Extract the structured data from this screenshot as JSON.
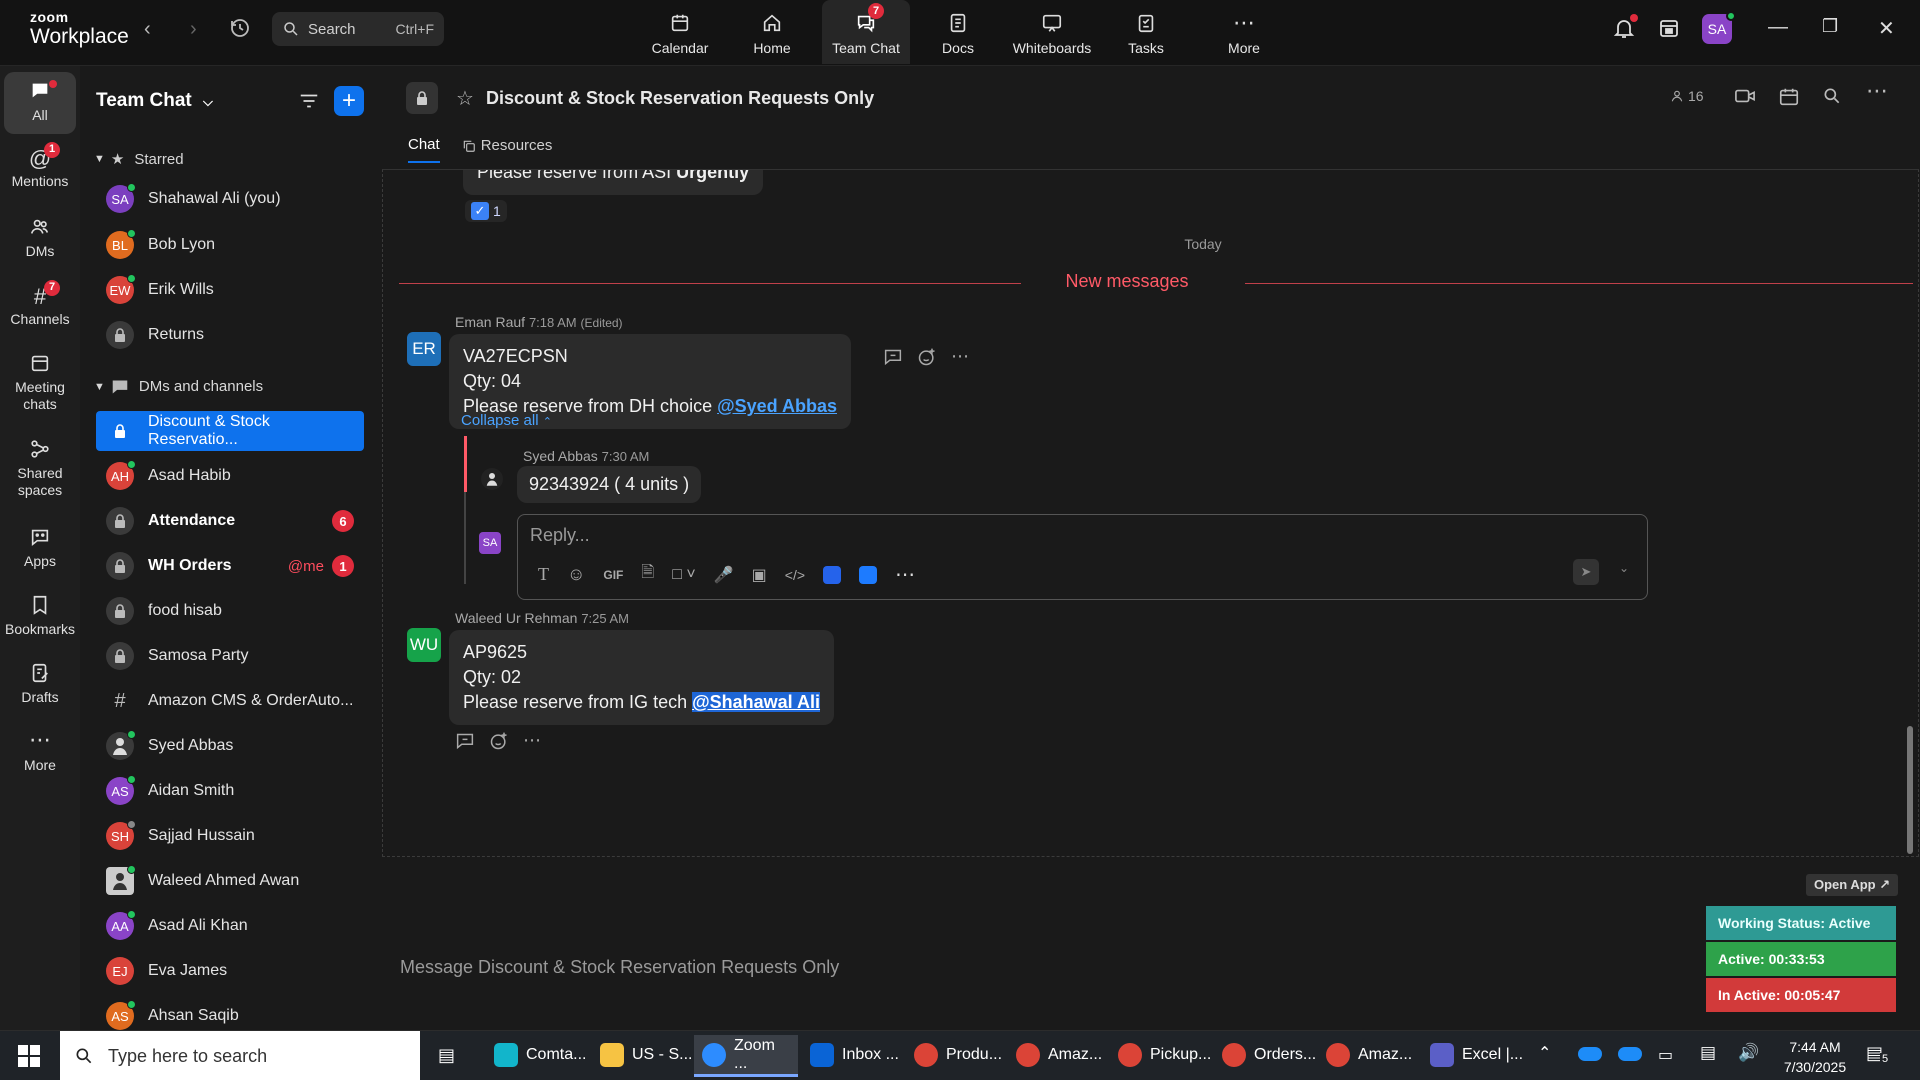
{
  "app": {
    "brand_top": "zoom",
    "brand_bottom": "Workplace"
  },
  "topbar": {
    "search_label": "Search",
    "search_shortcut": "Ctrl+F",
    "nav": [
      {
        "label": "Calendar"
      },
      {
        "label": "Home"
      },
      {
        "label": "Team Chat",
        "badge": "7"
      },
      {
        "label": "Docs"
      },
      {
        "label": "Whiteboards"
      },
      {
        "label": "Tasks"
      },
      {
        "label": "More"
      }
    ],
    "avatar_initials": "SA"
  },
  "rail": [
    {
      "label": "All"
    },
    {
      "label": "Mentions",
      "badge": "1"
    },
    {
      "label": "DMs"
    },
    {
      "label": "Channels",
      "badge": "7"
    },
    {
      "label": "Meeting chats"
    },
    {
      "label": "Shared spaces"
    },
    {
      "label": "Apps"
    },
    {
      "label": "Bookmarks"
    },
    {
      "label": "Drafts"
    },
    {
      "label": "More"
    }
  ],
  "sidebar": {
    "title": "Team Chat",
    "starred_label": "Starred",
    "starred": [
      {
        "name": "Shahawal Ali (you)",
        "initials": "SA",
        "color": "#7b3fbf"
      },
      {
        "name": "Bob Lyon",
        "initials": "BL",
        "color": "#e06b1f"
      },
      {
        "name": "Erik Wills",
        "initials": "EW",
        "color": "#d9433a"
      },
      {
        "name": "Returns",
        "initials": "",
        "color": ""
      }
    ],
    "dms_label": "DMs and channels",
    "items": [
      {
        "name": "Discount & Stock Reservatio...",
        "type": "lock"
      },
      {
        "name": "Asad Habib",
        "initials": "AH",
        "color": "#d9433a"
      },
      {
        "name": "Attendance",
        "type": "lock",
        "count": "6"
      },
      {
        "name": "WH Orders",
        "type": "lock",
        "mention": "@me",
        "count": "1"
      },
      {
        "name": "food hisab",
        "type": "lock"
      },
      {
        "name": "Samosa Party",
        "type": "lock"
      },
      {
        "name": "Amazon CMS & OrderAuto...",
        "type": "hash"
      },
      {
        "name": "Syed Abbas",
        "initials": "",
        "color": "#444"
      },
      {
        "name": "Aidan Smith",
        "initials": "AS",
        "color": "#8a44c7"
      },
      {
        "name": "Sajjad Hussain",
        "initials": "SH",
        "color": "#d9433a"
      },
      {
        "name": "Waleed Ahmed Awan",
        "initials": "",
        "color": "#555"
      },
      {
        "name": "Asad Ali Khan",
        "initials": "AA",
        "color": "#8a44c7"
      },
      {
        "name": "Eva James",
        "initials": "EJ",
        "color": "#d9433a"
      },
      {
        "name": "Ahsan Saqib",
        "initials": "AS",
        "color": "#e06b1f"
      }
    ]
  },
  "channel": {
    "title": "Discount & Stock Reservation Requests Only",
    "members": "16",
    "tabs": [
      "Chat",
      "Resources"
    ]
  },
  "messages": {
    "prev_text": "Please reserve from ASI ",
    "prev_bold": "Urgently",
    "reaction_count": "1",
    "day_label": "Today",
    "new_label": "New messages",
    "m1": {
      "sender": "Eman Rauf",
      "time": "7:18 AM",
      "edited": "(Edited)",
      "initials": "ER",
      "line1": "VA27ECPSN",
      "line2": "Qty: 04",
      "line3": "Please reserve from DH choice ",
      "mention": "@Syed Abbas"
    },
    "collapse_label": "Collapse all",
    "reply": {
      "sender": "Syed Abbas",
      "time": "7:30 AM",
      "text": "92343924 ( 4 units )"
    },
    "reply_placeholder": "Reply...",
    "reply_avatar": "SA",
    "m2": {
      "sender": "Waleed Ur Rehman",
      "time": "7:25 AM",
      "initials": "WU",
      "line1": "AP9625",
      "line2": "Qty: 02",
      "line3": "Please reserve from IG tech ",
      "mention": "@Shahawal Ali"
    }
  },
  "composer": {
    "placeholder": "Message Discount & Stock Reservation Requests Only",
    "gif": "GIF"
  },
  "widget": {
    "open_app": "Open App",
    "working": "Working Status: Active",
    "active": "Active: 00:33:53",
    "inactive": "In Active: 00:05:47",
    "colors": {
      "working": "#2e9a94",
      "active": "#2ea24a",
      "inactive": "#d23a3a"
    }
  },
  "taskbar": {
    "search_placeholder": "Type here to search",
    "apps": [
      {
        "label": "Comta..."
      },
      {
        "label": "US - S..."
      },
      {
        "label": "Zoom ..."
      },
      {
        "label": "Inbox ..."
      },
      {
        "label": "Produ..."
      },
      {
        "label": "Amaz..."
      },
      {
        "label": "Pickup..."
      },
      {
        "label": "Orders..."
      },
      {
        "label": "Amaz..."
      },
      {
        "label": "Excel |..."
      }
    ],
    "time": "7:44 AM",
    "date": "7/30/2025",
    "notif_count": "5"
  }
}
